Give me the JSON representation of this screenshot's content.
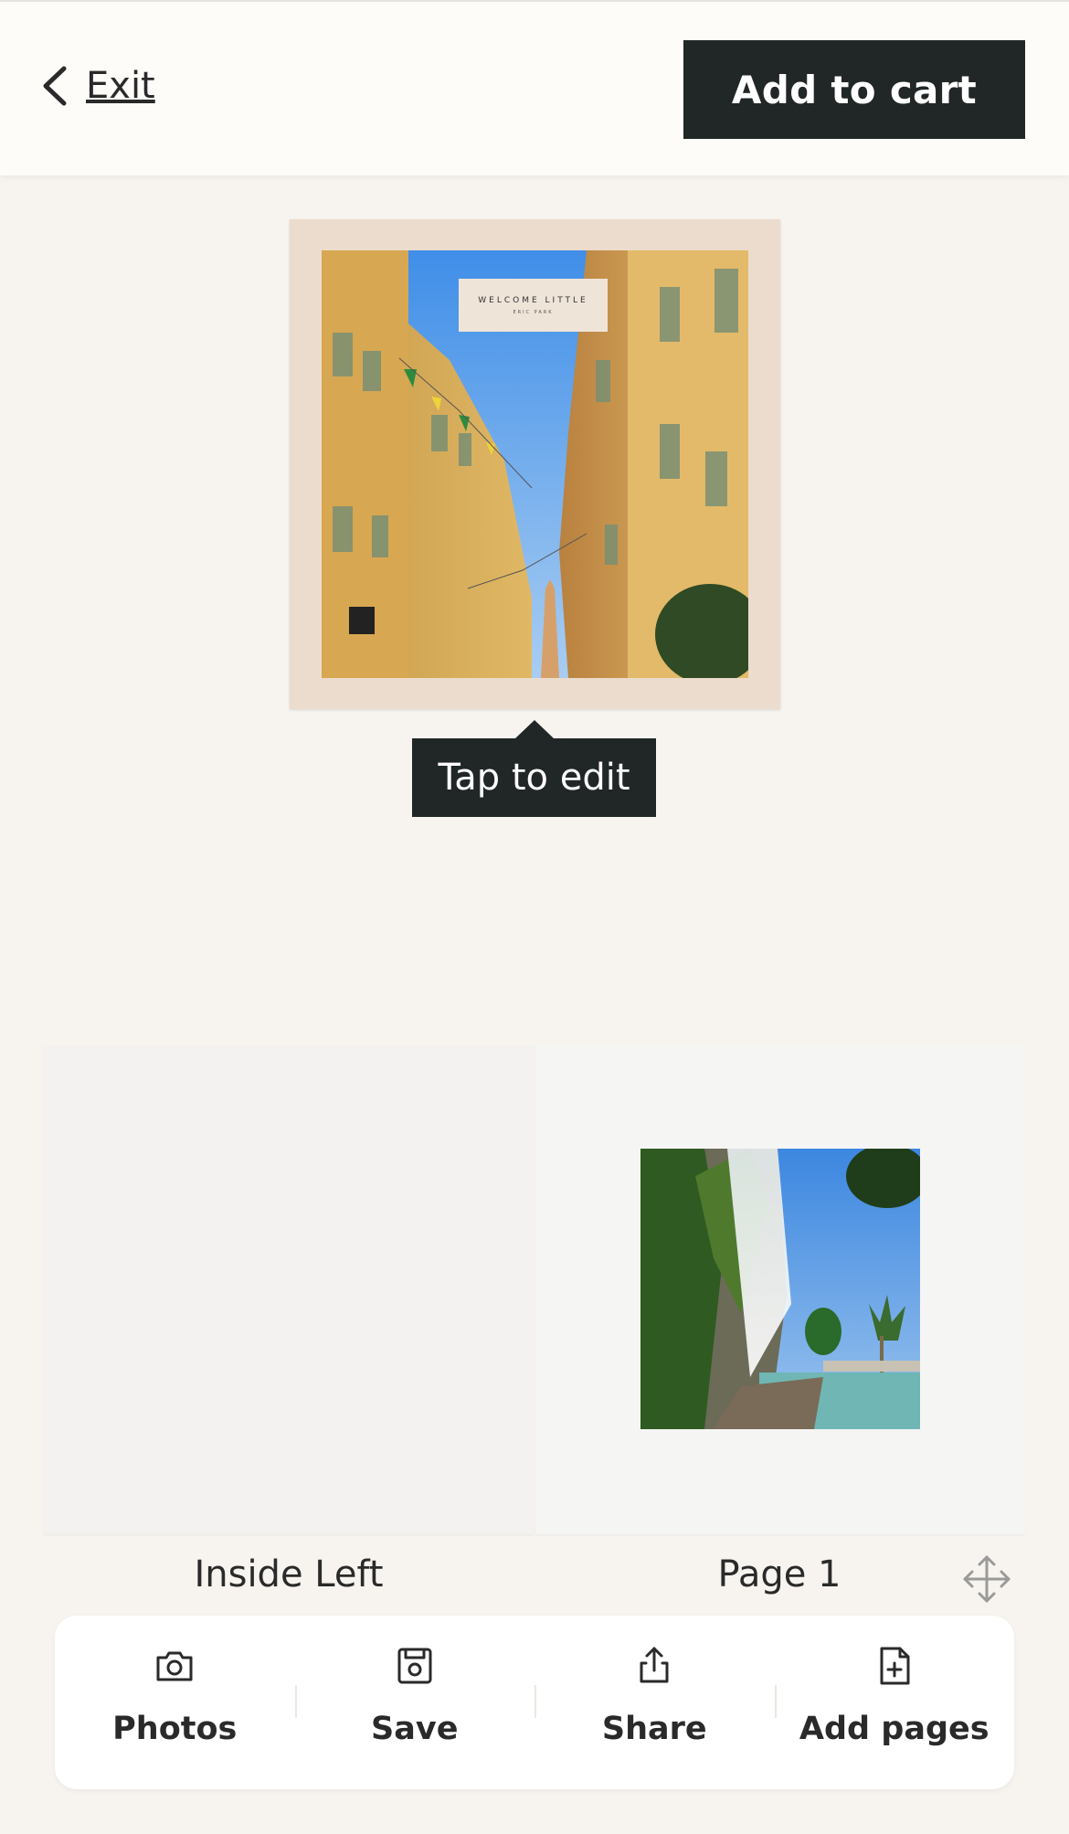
{
  "header": {
    "exit_label": "Exit",
    "cart_label": "Add to cart"
  },
  "cover": {
    "title_line1": "WELCOME LITTLE",
    "title_line2": "ERIC PARK"
  },
  "tooltip": {
    "text": "Tap to edit"
  },
  "spread": {
    "left_label": "Inside Left",
    "right_label": "Page 1"
  },
  "toolbar": {
    "items": [
      {
        "label": "Photos",
        "icon": "camera-icon"
      },
      {
        "label": "Save",
        "icon": "floppy-disk-icon"
      },
      {
        "label": "Share",
        "icon": "share-icon"
      },
      {
        "label": "Add pages",
        "icon": "add-page-icon"
      }
    ]
  },
  "colors": {
    "background": "#f7f4ef",
    "header_bg": "#fdfcf9",
    "dark_button": "#212626",
    "cover_border": "#ecdccd"
  }
}
